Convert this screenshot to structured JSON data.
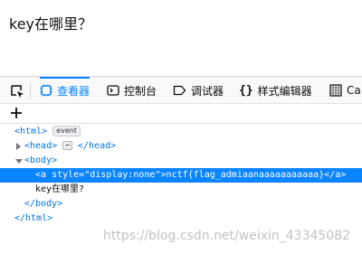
{
  "page": {
    "heading": "key在哪里？"
  },
  "devtools": {
    "tabs": [
      {
        "label": "查看器",
        "icon": "inspector-icon",
        "selected": true
      },
      {
        "label": "控制台",
        "icon": "console-icon"
      },
      {
        "label": "调试器",
        "icon": "debugger-icon"
      },
      {
        "label": "样式编辑器",
        "icon": "style-editor-icon"
      },
      {
        "label": "Ca",
        "icon": "performance-icon"
      }
    ],
    "accent_color": "#0a84ff"
  },
  "markup": {
    "html_open": "<html>",
    "event_badge": "event",
    "head_open": "<head>",
    "head_dots": "⋯",
    "head_close": "</head>",
    "body_open": "<body>",
    "a_tag_open": "<a",
    "a_attr_name": "style",
    "a_attr_eq": "=",
    "a_attr_value": "\"display:none\"",
    "a_tag_end": ">",
    "a_text": "nctf{flag_admiaanaaaaaaaaaaa}",
    "a_close": "</a>",
    "body_text": "key在哪里?",
    "body_close": "</body>",
    "html_close": "</html>"
  },
  "watermark": "https://blog.csdn.net/weixin_43345082"
}
